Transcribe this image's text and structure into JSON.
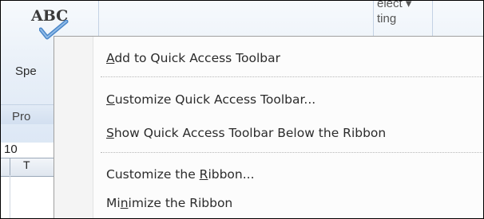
{
  "ribbon": {
    "spelling_icon_text": "ABC",
    "spelling_label_fragment": "Spe",
    "group_label_fragment": "Pro",
    "select_label_fragment": "elect ▾",
    "editing_label_fragment": "ting"
  },
  "sheet": {
    "row_number": "10",
    "column_header": "T"
  },
  "context_menu": {
    "items": [
      {
        "pre": "",
        "key": "A",
        "post": "dd to Quick Access Toolbar"
      },
      {
        "pre": "",
        "key": "C",
        "post": "ustomize Quick Access Toolbar..."
      },
      {
        "pre": "",
        "key": "S",
        "post": "how Quick Access Toolbar Below the Ribbon"
      },
      {
        "pre": "Customize the ",
        "key": "R",
        "post": "ibbon..."
      },
      {
        "pre": "Mi",
        "key": "n",
        "post": "imize the Ribbon"
      }
    ]
  },
  "colors": {
    "ribbon_top": "#f7fafd",
    "ribbon_bottom": "#dce7f5",
    "menu_background": "#fcfcfc",
    "menu_gutter": "#f4f4f4",
    "check_blue": "#4a86c8"
  }
}
